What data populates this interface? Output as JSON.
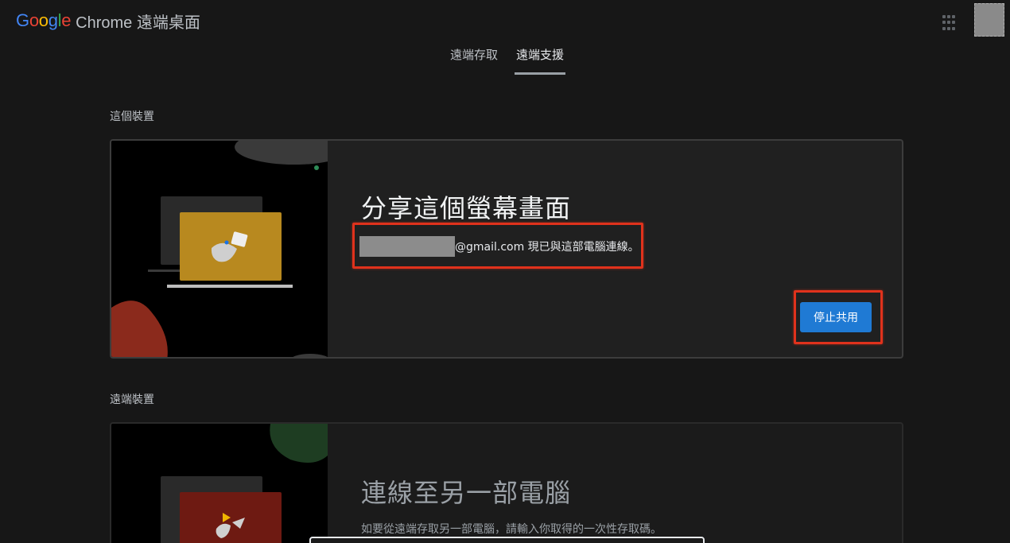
{
  "header": {
    "logo_word": "Google",
    "app_name": "Chrome 遠端桌面",
    "apps_icon": "grid-apps-icon",
    "avatar": "user-avatar-icon"
  },
  "tabs": [
    {
      "label": "遠端存取",
      "active": false
    },
    {
      "label": "遠端支援",
      "active": true
    }
  ],
  "this_device": {
    "section_label": "這個裝置",
    "title": "分享這個螢幕畫面",
    "status_suffix": "@gmail.com 現已與這部電腦連線。",
    "stop_button": "停止共用"
  },
  "remote_device": {
    "section_label": "遠端裝置",
    "title": "連線至另一部電腦",
    "hint": "如要從遠端存取另一部電腦，請輸入你取得的一次性存取碼。"
  },
  "colors": {
    "background": "#171717",
    "card": "#202020",
    "accent_button": "#1f7ad4",
    "highlight_annotation": "#e0321c"
  }
}
